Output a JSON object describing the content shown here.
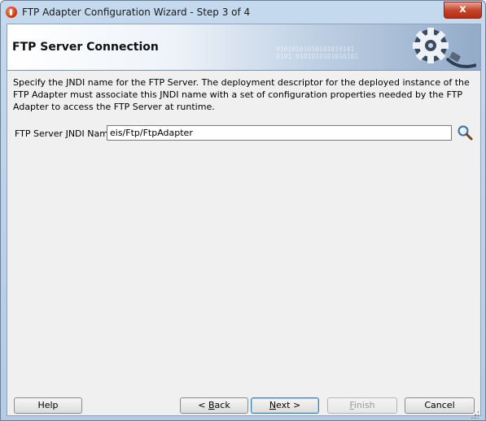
{
  "window": {
    "title": "FTP Adapter Configuration Wizard - Step 3 of 4",
    "close_label": "x"
  },
  "banner": {
    "title": "FTP Server Connection",
    "binary_pattern": [
      "01010101010101010101",
      "0101 0101010101010101"
    ]
  },
  "main": {
    "description": "Specify the JNDI name for the FTP Server. The deployment descriptor for the deployed instance of the FTP Adapter must associate this JNDI name with a set of configuration properties needed by the FTP Adapter to access the FTP Server at runtime.",
    "jndi_label_pre": "FTP Server ",
    "jndi_label_mnemonic": "J",
    "jndi_label_post": "NDI Name",
    "jndi_value": "eis/Ftp/FtpAdapter"
  },
  "footer": {
    "help_label": "Help",
    "back_prefix": "< ",
    "back_mnemonic": "B",
    "back_rest": "ack",
    "next_mnemonic": "N",
    "next_rest": "ext >",
    "finish_mnemonic": "F",
    "finish_rest": "inish",
    "cancel_label": "Cancel"
  },
  "icons": {
    "app": "oracle-app-icon",
    "banner": "gear-plug-icon",
    "browse": "magnifier-icon",
    "resize": "resize-grip-icon"
  }
}
